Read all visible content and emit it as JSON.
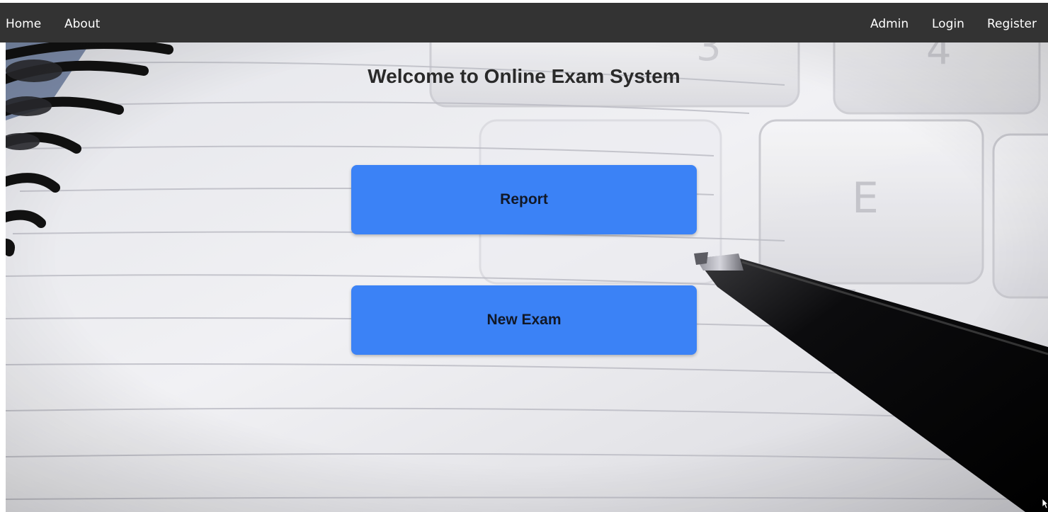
{
  "nav": {
    "left_items": [
      {
        "label": "Home"
      },
      {
        "label": "About"
      }
    ],
    "right_items": [
      {
        "label": "Admin"
      },
      {
        "label": "Login"
      },
      {
        "label": "Register"
      }
    ]
  },
  "main": {
    "title": "Welcome to Online Exam System",
    "buttons": [
      {
        "label": "Report"
      },
      {
        "label": "New Exam"
      }
    ]
  },
  "background": {
    "image": "notebook-keyboard-pen-photo",
    "key_labels": [
      "3",
      "4",
      "E"
    ]
  },
  "colors": {
    "navbar": "#333333",
    "nav_text": "#ffffff",
    "button": "#3b82f6",
    "button_text": "#111827",
    "title_text": "#2a2a2a"
  }
}
